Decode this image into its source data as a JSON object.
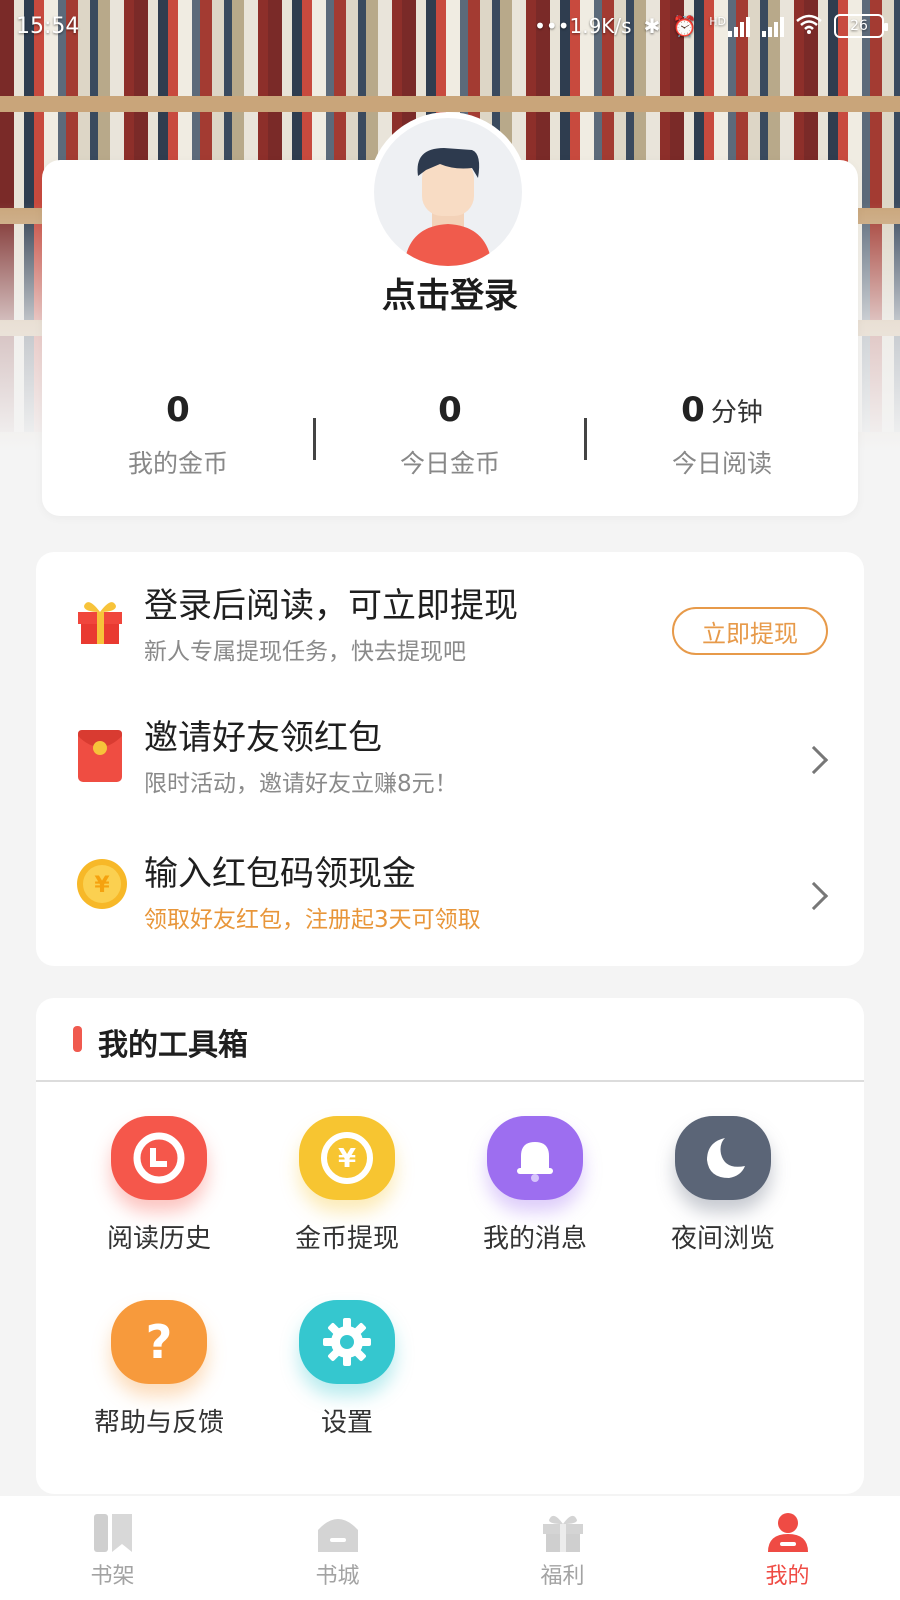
{
  "status_bar": {
    "time": "15:54",
    "net_speed": "1.9K/s",
    "network_badge": "HD",
    "battery": "26"
  },
  "profile": {
    "login_prompt": "点击登录",
    "stats": [
      {
        "value": "0",
        "unit": "",
        "label": "我的金币"
      },
      {
        "value": "0",
        "unit": "",
        "label": "今日金币"
      },
      {
        "value": "0",
        "unit": "分钟",
        "label": "今日阅读"
      }
    ]
  },
  "tasks": [
    {
      "icon": "gift-icon",
      "title": "登录后阅读，可立即提现",
      "subtitle": "新人专属提现任务，快去提现吧",
      "action_label": "立即提现",
      "subtitle_color": "#8a8a8a"
    },
    {
      "icon": "red-envelope-icon",
      "title": "邀请好友领红包",
      "subtitle": "限时活动，邀请好友立赚8元！",
      "subtitle_color": "#8a8a8a"
    },
    {
      "icon": "coin-icon",
      "title": "输入红包码领现金",
      "subtitle": "领取好友红包，注册起3天可领取",
      "subtitle_color": "#e8963a"
    }
  ],
  "toolbox": {
    "title": "我的工具箱",
    "items": [
      {
        "icon": "clock-icon",
        "label": "阅读历史",
        "color": "#f5574b"
      },
      {
        "icon": "yuan-coin-icon",
        "label": "金币提现",
        "color": "#f7c531"
      },
      {
        "icon": "bell-icon",
        "label": "我的消息",
        "color": "#9d6ef0"
      },
      {
        "icon": "moon-icon",
        "label": "夜间浏览",
        "color": "#5b6577"
      },
      {
        "icon": "question-icon",
        "label": "帮助与反馈",
        "color": "#f79a3c"
      },
      {
        "icon": "gear-icon",
        "label": "设置",
        "color": "#35c7cf"
      }
    ]
  },
  "bottom_nav": {
    "items": [
      {
        "icon": "bookshelf-icon",
        "label": "书架",
        "active": false
      },
      {
        "icon": "bookstore-icon",
        "label": "书城",
        "active": false
      },
      {
        "icon": "gift-box-icon",
        "label": "福利",
        "active": false
      },
      {
        "icon": "profile-icon",
        "label": "我的",
        "active": true
      }
    ],
    "active_color": "#ef4b44",
    "inactive_color": "#a3a3a3"
  }
}
